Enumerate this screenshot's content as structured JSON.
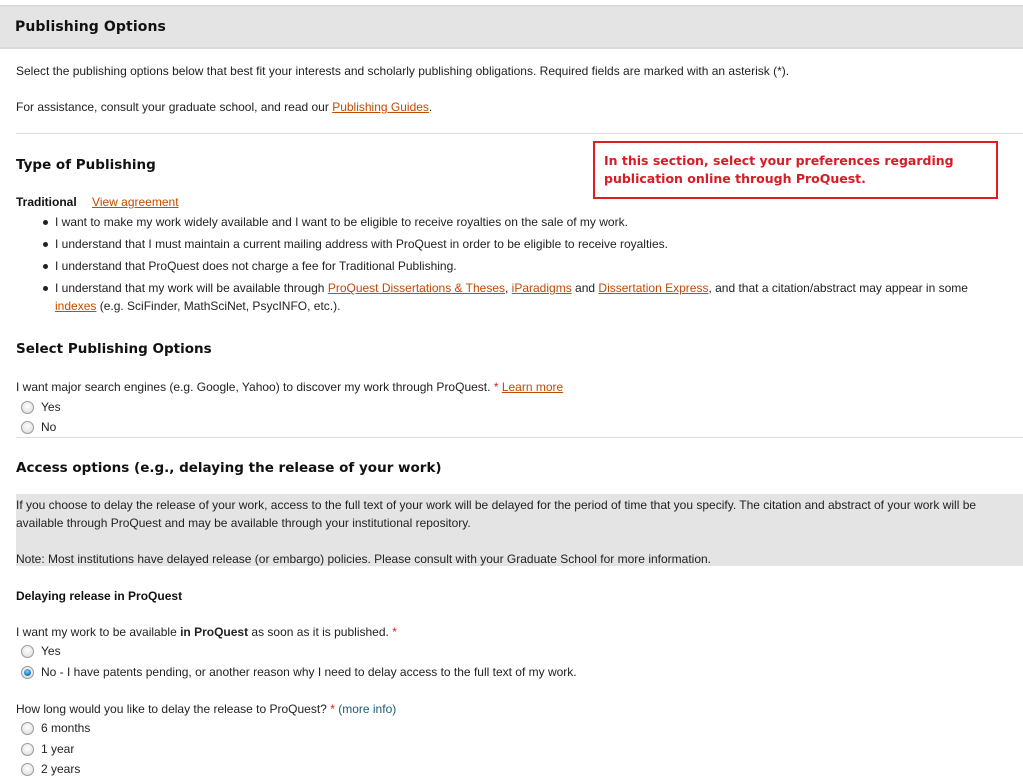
{
  "header": {
    "title": "Publishing Options"
  },
  "intro": {
    "line1": "Select the publishing options below that best fit your interests and scholarly publishing obligations. Required fields are marked with an asterisk (*).",
    "line2_prefix": "For assistance, consult your graduate school, and read our ",
    "line2_link": "Publishing Guides",
    "line2_suffix": "."
  },
  "callout": {
    "text": "In this section, select your preferences regarding publication online through ProQuest."
  },
  "type_of_publishing": {
    "heading": "Type of Publishing",
    "type_label": "Traditional",
    "agreement_link": "View agreement",
    "bullets": [
      "I want to make my work widely available and I want to be eligible to receive royalties on the sale of my work.",
      "I understand that I must maintain a current mailing address with ProQuest in order to be eligible to receive royalties.",
      "I understand that ProQuest does not charge a fee for Traditional Publishing."
    ],
    "bullet4": {
      "prefix": "I understand that my work will be available through ",
      "link1": "ProQuest Dissertations & Theses",
      "sep1": ", ",
      "link2": "iParadigms",
      "sep2": " and ",
      "link3": "Dissertation Express",
      "mid": ", and that a citation/abstract may appear in some ",
      "link4": "indexes",
      "suffix": " (e.g. SciFinder, MathSciNet, PsycINFO, etc.)."
    }
  },
  "publishing_options": {
    "heading": "Select Publishing Options",
    "question": "I want major search engines (e.g. Google, Yahoo) to discover my work through ProQuest.",
    "required_mark": "*",
    "learn_more": "Learn more",
    "options": [
      {
        "label": "Yes",
        "checked": false
      },
      {
        "label": "No",
        "checked": false
      }
    ]
  },
  "access_options": {
    "heading": "Access options (e.g., delaying the release of your work)",
    "info": "If you choose to delay the release of your work, access to the full text of your work will be delayed for the period of time that you specify. The citation and abstract of your work will be available through ProQuest and may be available through your institutional repository.",
    "note": "Note: Most institutions have delayed release (or embargo) policies. Please consult with your Graduate School for more information."
  },
  "delaying": {
    "heading": "Delaying release in ProQuest",
    "question_prefix": "I want my work to be available ",
    "question_bold": "in ProQuest",
    "question_suffix": " as soon as it is published.",
    "required_mark": "*",
    "options": [
      {
        "label": "Yes",
        "checked": false
      },
      {
        "label": "No - I have patents pending, or another reason why I need to delay access to the full text of my work.",
        "checked": true
      }
    ]
  },
  "delay_length": {
    "question": "How long would you like to delay the release to ProQuest?",
    "required_mark": "*",
    "more_info": "(more info)",
    "options": [
      {
        "label": "6 months",
        "checked": false
      },
      {
        "label": "1 year",
        "checked": false
      },
      {
        "label": "2 years",
        "checked": false
      }
    ]
  }
}
